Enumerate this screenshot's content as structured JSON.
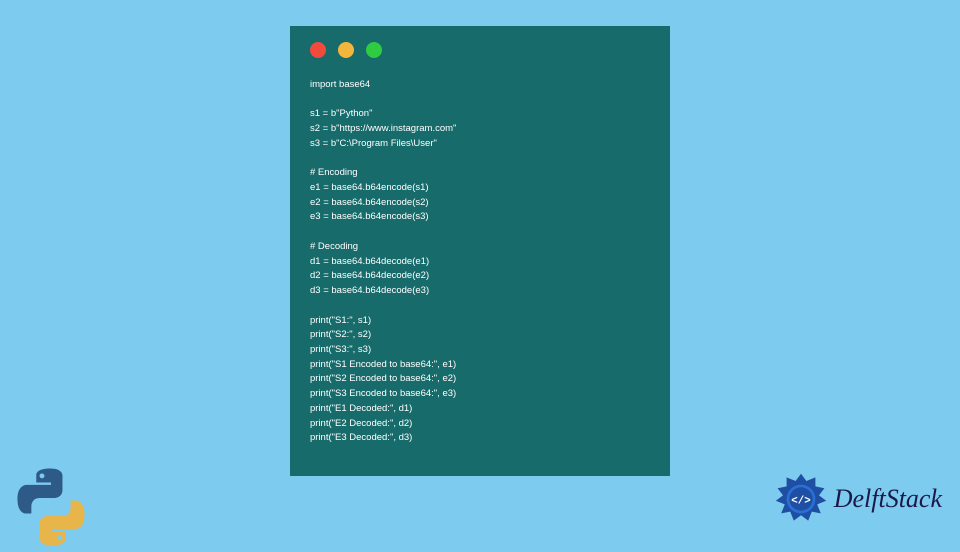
{
  "window": {
    "dots": [
      "red",
      "yellow",
      "green"
    ]
  },
  "code": {
    "lines": [
      "import base64",
      "",
      "s1 = b\"Python\"",
      "s2 = b\"https://www.instagram.com\"",
      "s3 = b\"C:\\Program Files\\User\"",
      "",
      "# Encoding",
      "e1 = base64.b64encode(s1)",
      "e2 = base64.b64encode(s2)",
      "e3 = base64.b64encode(s3)",
      "",
      "# Decoding",
      "d1 = base64.b64decode(e1)",
      "d2 = base64.b64decode(e2)",
      "d3 = base64.b64decode(e3)",
      "",
      "print(\"S1:\", s1)",
      "print(\"S2:\", s2)",
      "print(\"S3:\", s3)",
      "print(\"S1 Encoded to base64:\", e1)",
      "print(\"S2 Encoded to base64:\", e2)",
      "print(\"S3 Encoded to base64:\", e3)",
      "print(\"E1 Decoded:\", d1)",
      "print(\"E2 Decoded:\", d2)",
      "print(\"E3 Decoded:\", d3)"
    ]
  },
  "branding": {
    "site_name": "DelftStack"
  }
}
